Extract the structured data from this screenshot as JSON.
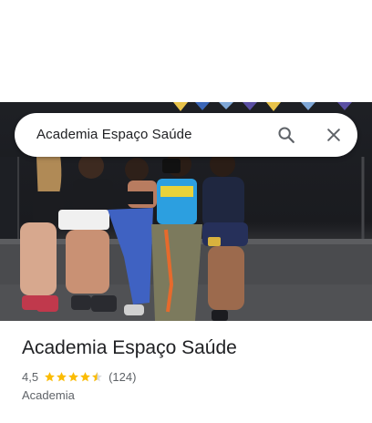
{
  "search": {
    "query": "Academia Espaço Saúde"
  },
  "place": {
    "name": "Academia Espaço Saúde",
    "rating": "4,5",
    "rating_value": 4.5,
    "review_count": "(124)",
    "category": "Academia"
  },
  "colors": {
    "star": "#fbbc04",
    "star_empty": "#dadce0",
    "text_primary": "#202124",
    "text_secondary": "#5f6368"
  },
  "icons": {
    "search": "search-icon",
    "close": "close-icon",
    "star": "star-icon"
  }
}
